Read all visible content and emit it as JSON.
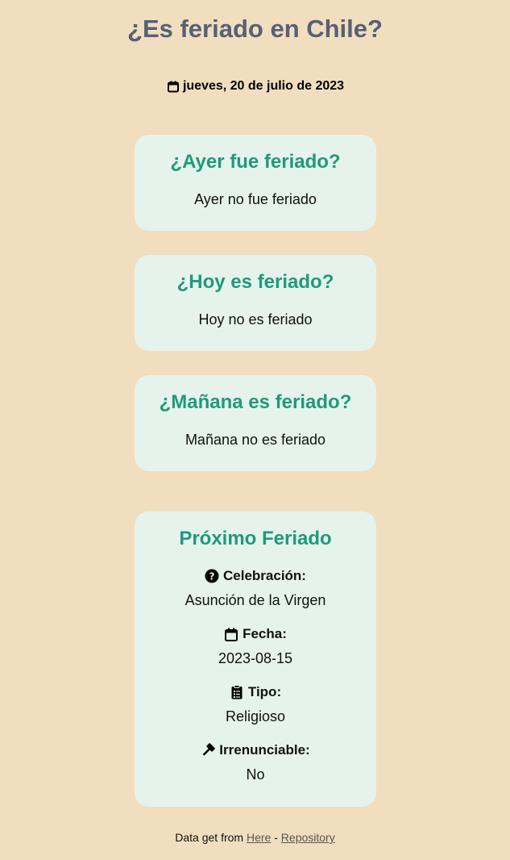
{
  "header": {
    "title": "¿Es feriado en Chile?",
    "date": "jueves, 20 de julio de 2023"
  },
  "cards": {
    "yesterday": {
      "question": "¿Ayer fue feriado?",
      "answer": "Ayer no fue feriado"
    },
    "today": {
      "question": "¿Hoy es feriado?",
      "answer": "Hoy no es feriado"
    },
    "tomorrow": {
      "question": "¿Mañana es feriado?",
      "answer": "Mañana no es feriado"
    }
  },
  "next_holiday": {
    "title": "Próximo Feriado",
    "celebration_label": "Celebración:",
    "celebration_value": "Asunción de la Virgen",
    "date_label": "Fecha:",
    "date_value": "2023-08-15",
    "type_label": "Tipo:",
    "type_value": "Religioso",
    "irrenunciable_label": "Irrenunciable:",
    "irrenunciable_value": "No"
  },
  "footer": {
    "prefix": "Data get from",
    "here_link": "Here",
    "separator": "-",
    "repo_link": "Repository"
  },
  "colors": {
    "background": "#f1debf",
    "card": "#e6f3ec",
    "accent": "#1f9a7b",
    "title": "#566078"
  },
  "icons": {
    "date": "calendar-icon",
    "celebration": "question-circle-icon",
    "type": "clipboard-list-icon",
    "irrenunciable": "gavel-icon"
  }
}
